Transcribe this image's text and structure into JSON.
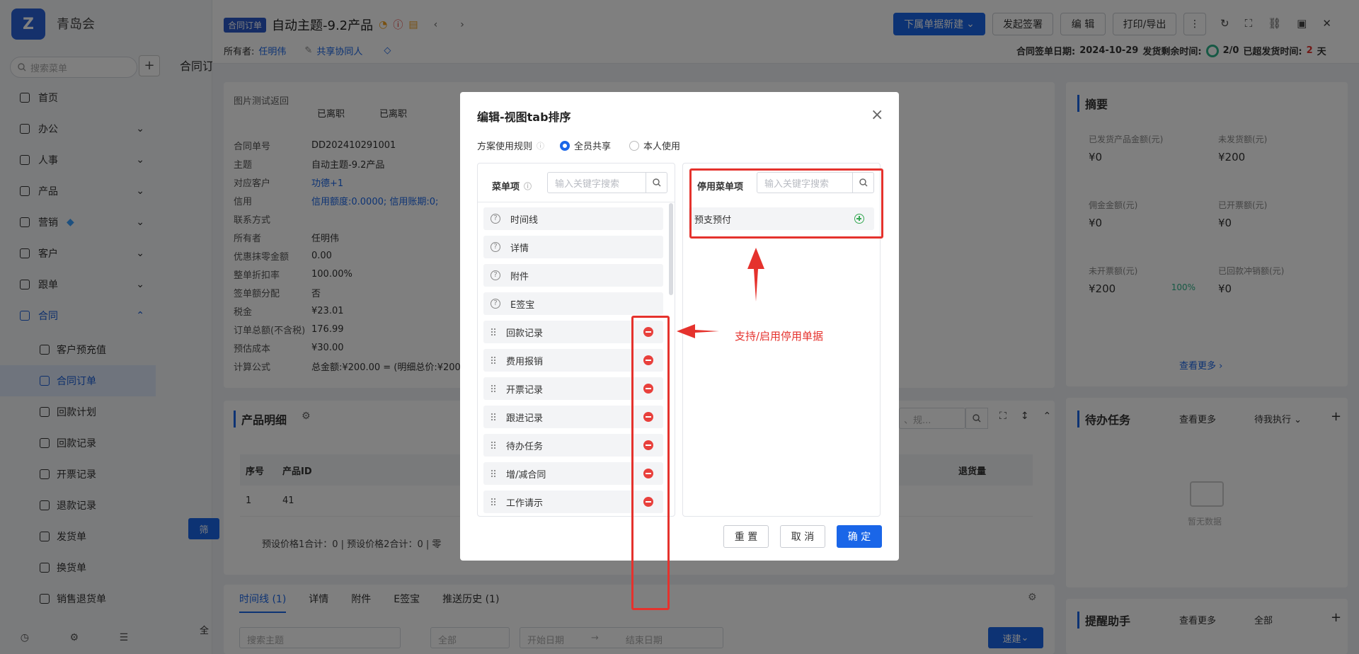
{
  "nav": {
    "company": "青岛会",
    "search_placeholder": "搜索菜单",
    "items": [
      {
        "label": "首页"
      },
      {
        "label": "办公"
      },
      {
        "label": "人事"
      },
      {
        "label": "产品"
      },
      {
        "label": "营销"
      },
      {
        "label": "客户"
      },
      {
        "label": "跟单"
      },
      {
        "label": "合同"
      }
    ],
    "sub_items": [
      {
        "label": "客户预充值"
      },
      {
        "label": "合同订单"
      },
      {
        "label": "回款计划"
      },
      {
        "label": "回款记录"
      },
      {
        "label": "开票记录"
      },
      {
        "label": "退款记录"
      },
      {
        "label": "发货单"
      },
      {
        "label": "换货单"
      },
      {
        "label": "销售退货单"
      }
    ]
  },
  "header": {
    "tag": "合同订单",
    "title": "自动主题-9.2产品",
    "owner_label": "所有者:",
    "owner": "任明伟",
    "share": "共享协同人",
    "buttons": {
      "new_sub": "下属单据新建",
      "sign": "发起签署",
      "edit": "编 辑",
      "print": "打印/导出"
    },
    "sign_date_label": "合同签单日期:",
    "sign_date": "2024-10-29",
    "ship_remain_label": "发货剩余时间:",
    "ship_ratio": "2/0",
    "overdue_label": "已超发货时间:",
    "overdue_value": "2",
    "overdue_unit": "天",
    "page_crumb": "合同订"
  },
  "detail": {
    "img_label": "图片测试返回",
    "resigned_1": "已离职",
    "resigned_2": "已离职",
    "rows": [
      {
        "k": "合同单号",
        "v": "DD202410291001"
      },
      {
        "k": "主题",
        "v": "自动主题-9.2产品"
      },
      {
        "k": "对应客户",
        "v": "功德+1"
      },
      {
        "k": "信用",
        "v": "信用额度:0.0000; 信用账期:0;"
      },
      {
        "k": "联系方式",
        "v": ""
      },
      {
        "k": "所有者",
        "v": "任明伟"
      },
      {
        "k": "优惠抹零金额",
        "v": "0.00"
      },
      {
        "k": "整单折扣率",
        "v": "100.00%"
      },
      {
        "k": "签单额分配",
        "v": "否"
      },
      {
        "k": "税金",
        "v": "¥23.01"
      },
      {
        "k": "订单总额(不含税)",
        "v": "176.99"
      },
      {
        "k": "预估成本",
        "v": "¥30.00"
      },
      {
        "k": "计算公式",
        "v": "总金额:¥200.00 = (明细总价:¥200.0"
      }
    ]
  },
  "products": {
    "title": "产品明细",
    "search_placeholder": "、规...",
    "cols": [
      "序号",
      "产品ID",
      "退货量"
    ],
    "row": [
      "1",
      "41"
    ],
    "footer": "预设价格1合计：0 |    预设价格2合计：0 |    零",
    "filter_btn": "筛"
  },
  "bottom_tabs": {
    "items": [
      "时间线 (1)",
      "详情",
      "附件",
      "E签宝",
      "推送历史 (1)"
    ],
    "search_placeholder": "搜索主题",
    "all": "全部",
    "start": "开始日期",
    "end": "结束日期",
    "quick": "速建",
    "all_left": "全"
  },
  "summary": {
    "title": "摘要",
    "cells": [
      {
        "label": "已发货产品金额(元)",
        "value": "¥0",
        "pct": ""
      },
      {
        "label": "未发货额(元)",
        "value": "¥200",
        "pct": ""
      },
      {
        "label": "佣金金额(元)",
        "value": "¥0",
        "pct": ""
      },
      {
        "label": "已开票额(元)",
        "value": "¥0",
        "pct": ""
      },
      {
        "label": "未开票额(元)",
        "value": "¥200",
        "pct": "100%"
      },
      {
        "label": "已回款冲销额(元)",
        "value": "¥0",
        "pct": ""
      }
    ],
    "more": "查看更多"
  },
  "todo": {
    "title": "待办任务",
    "more": "查看更多",
    "filter": "待我执行",
    "empty": "暂无数据"
  },
  "reminder": {
    "title": "提醒助手",
    "more": "查看更多",
    "filter": "全部"
  },
  "modal": {
    "title": "编辑-视图tab排序",
    "rule_label": "方案使用规则",
    "radio_all": "全员共享",
    "radio_self": "本人使用",
    "left_title": "菜单项",
    "right_title": "停用菜单项",
    "search_placeholder": "输入关键字搜索",
    "fixed_items": [
      "时间线",
      "详情",
      "附件",
      "E签宝"
    ],
    "enabled_items": [
      "回款记录",
      "费用报销",
      "开票记录",
      "跟进记录",
      "待办任务",
      "增/减合同",
      "工作请示"
    ],
    "disabled_items": [
      "预支预付"
    ],
    "annotation": "支持/启用停用单据",
    "btn_reset": "重 置",
    "btn_cancel": "取 消",
    "btn_ok": "确 定"
  },
  "colors": {
    "primary": "#1a66e8",
    "annotation": "#e5322d",
    "overlay": "rgba(0,0,0,0.5)"
  }
}
